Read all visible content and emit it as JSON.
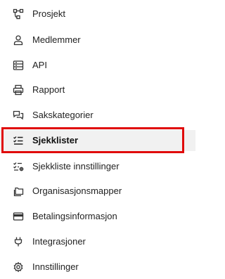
{
  "menu": {
    "items": [
      {
        "label": "Prosjekt",
        "icon": "project-nodes-icon"
      },
      {
        "label": "Medlemmer",
        "icon": "user-icon"
      },
      {
        "label": "API",
        "icon": "server-icon"
      },
      {
        "label": "Rapport",
        "icon": "printer-icon"
      },
      {
        "label": "Sakskategorier",
        "icon": "chat-bubbles-icon"
      },
      {
        "label": "Sjekklister",
        "icon": "checklist-icon",
        "active": true
      },
      {
        "label": "Sjekkliste innstillinger",
        "icon": "checklist-settings-icon"
      },
      {
        "label": "Organisasjonsmapper",
        "icon": "folders-icon"
      },
      {
        "label": "Betalingsinformasjon",
        "icon": "credit-card-icon"
      },
      {
        "label": "Integrasjoner",
        "icon": "plug-icon"
      },
      {
        "label": "Innstillinger",
        "icon": "gear-icon"
      }
    ]
  },
  "colors": {
    "highlight_border": "#e00a0a",
    "active_background": "#f1f1f1",
    "text": "#222222"
  }
}
